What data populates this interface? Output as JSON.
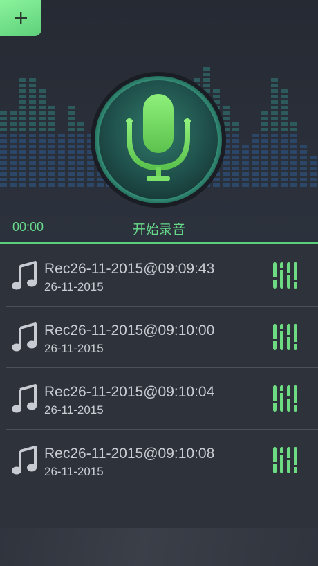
{
  "header": {
    "add_icon": "plus-icon",
    "timer": "00:00",
    "record_label": "开始录音",
    "record_icon": "microphone-icon",
    "accent_color": "#5ed07a"
  },
  "recordings": [
    {
      "name": "Rec26-11-2015@09:09:43",
      "date": "26-11-2015"
    },
    {
      "name": "Rec26-11-2015@09:10:00",
      "date": "26-11-2015"
    },
    {
      "name": "Rec26-11-2015@09:10:04",
      "date": "26-11-2015"
    },
    {
      "name": "Rec26-11-2015@09:10:08",
      "date": "26-11-2015"
    }
  ],
  "row_icons": {
    "left": "music-note-icon",
    "right": "equalizer-icon"
  }
}
